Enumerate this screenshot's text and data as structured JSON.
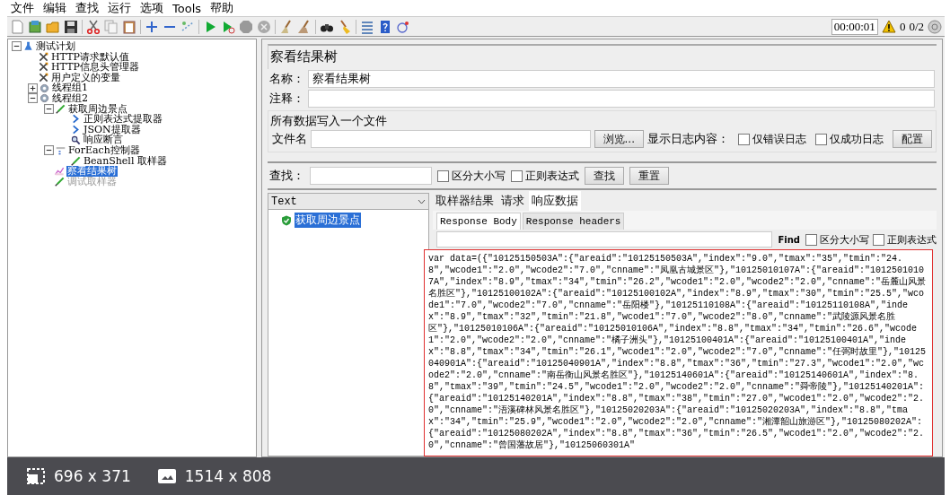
{
  "menu": [
    "文件",
    "编辑",
    "查找",
    "运行",
    "选项",
    "Tools",
    "帮助"
  ],
  "toolbar": {
    "timer": "00:00:01",
    "error_count": "0",
    "threads": "0/2"
  },
  "tree": [
    {
      "label": "测试计划",
      "kind": "plan",
      "expanded": true,
      "selected": false,
      "disabled": false,
      "children": [
        {
          "label": "HTTP请求默认值",
          "kind": "config",
          "selected": false,
          "disabled": false
        },
        {
          "label": "HTTP信息头管理器",
          "kind": "config",
          "selected": false,
          "disabled": false
        },
        {
          "label": "用户定义的变量",
          "kind": "config",
          "selected": false,
          "disabled": false
        },
        {
          "label": "线程组1",
          "kind": "threadgroup",
          "expanded": false,
          "selected": false,
          "disabled": false
        },
        {
          "label": "线程组2",
          "kind": "threadgroup",
          "expanded": true,
          "selected": false,
          "disabled": false,
          "children": [
            {
              "label": "获取周边景点",
              "kind": "sampler",
              "expanded": true,
              "selected": false,
              "disabled": false,
              "children": [
                {
                  "label": "正则表达式提取器",
                  "kind": "postprocessor",
                  "selected": false,
                  "disabled": false
                },
                {
                  "label": "JSON提取器",
                  "kind": "postprocessor",
                  "selected": false,
                  "disabled": false
                },
                {
                  "label": "响应断言",
                  "kind": "assertion",
                  "selected": false,
                  "disabled": false
                }
              ]
            },
            {
              "label": "ForEach控制器",
              "kind": "controller",
              "expanded": true,
              "selected": false,
              "disabled": false,
              "children": [
                {
                  "label": "BeanShell 取样器",
                  "kind": "sampler",
                  "selected": false,
                  "disabled": false
                }
              ]
            },
            {
              "label": "察看结果树",
              "kind": "listener",
              "selected": true,
              "disabled": false
            },
            {
              "label": "调试取样器",
              "kind": "sampler",
              "selected": false,
              "disabled": true
            }
          ]
        }
      ]
    }
  ],
  "editor": {
    "title": "察看结果树",
    "name_label": "名称：",
    "name_value": "察看结果树",
    "comment_label": "注释：",
    "file_group": {
      "legend": "所有数据写入一个文件",
      "filename_label": "文件名",
      "browse": "浏览...",
      "log_label": "显示日志内容：",
      "checks": [
        {
          "label": "仅错误日志",
          "checked": false
        },
        {
          "label": "仅成功日志",
          "checked": false
        }
      ],
      "config": "配置"
    },
    "search": {
      "label": "查找：",
      "checks": [
        {
          "label": "区分大小写",
          "checked": false
        },
        {
          "label": "正则表达式",
          "checked": false
        }
      ],
      "buttons": [
        "查找",
        "重置"
      ]
    },
    "results": {
      "renderer": "Text",
      "items": [
        {
          "label": "获取周边景点",
          "success": true,
          "selected": true
        }
      ],
      "tabs": [
        {
          "label": "取样器结果",
          "selected": false
        },
        {
          "label": "请求",
          "selected": false
        },
        {
          "label": "响应数据",
          "selected": true
        }
      ],
      "subtabs": [
        {
          "label": "Response Body",
          "selected": true
        },
        {
          "label": "Response headers",
          "selected": false
        }
      ],
      "find": {
        "button": "Find",
        "checks": [
          {
            "label": "区分大小写",
            "checked": false
          },
          {
            "label": "正则表达式",
            "checked": false
          }
        ]
      },
      "response": "var data=({\"10125150503A\":{\"areaid\":\"10125150503A\",\"index\":\"9.0\",\"tmax\":\"35\",\"tmin\":\"24.8\",\"wcode1\":\"2.0\",\"wcode2\":\"7.0\",\"cnname\":\"凤凰古城景区\"},\"10125010107A\":{\"areaid\":\"10125010107A\",\"index\":\"8.9\",\"tmax\":\"34\",\"tmin\":\"26.2\",\"wcode1\":\"2.0\",\"wcode2\":\"2.0\",\"cnname\":\"岳麓山风景名胜区\"},\"10125100102A\":{\"areaid\":\"10125100102A\",\"index\":\"8.9\",\"tmax\":\"30\",\"tmin\":\"25.5\",\"wcode1\":\"7.0\",\"wcode2\":\"7.0\",\"cnname\":\"岳阳楼\"},\"10125110108A\":{\"areaid\":\"10125110108A\",\"index\":\"8.9\",\"tmax\":\"32\",\"tmin\":\"21.8\",\"wcode1\":\"7.0\",\"wcode2\":\"8.0\",\"cnname\":\"武陵源风景名胜区\"},\"10125010106A\":{\"areaid\":\"10125010106A\",\"index\":\"8.8\",\"tmax\":\"34\",\"tmin\":\"26.6\",\"wcode1\":\"2.0\",\"wcode2\":\"2.0\",\"cnname\":\"橘子洲头\"},\"10125100401A\":{\"areaid\":\"10125100401A\",\"index\":\"8.8\",\"tmax\":\"34\",\"tmin\":\"26.1\",\"wcode1\":\"2.0\",\"wcode2\":\"7.0\",\"cnname\":\"任弼时故里\"},\"10125040901A\":{\"areaid\":\"10125040901A\",\"index\":\"8.8\",\"tmax\":\"36\",\"tmin\":\"27.3\",\"wcode1\":\"2.0\",\"wcode2\":\"2.0\",\"cnname\":\"南岳衡山风景名胜区\"},\"10125140601A\":{\"areaid\":\"10125140601A\",\"index\":\"8.8\",\"tmax\":\"39\",\"tmin\":\"24.5\",\"wcode1\":\"2.0\",\"wcode2\":\"2.0\",\"cnname\":\"舜帝陵\"},\"10125140201A\":{\"areaid\":\"10125140201A\",\"index\":\"8.8\",\"tmax\":\"38\",\"tmin\":\"27.0\",\"wcode1\":\"2.0\",\"wcode2\":\"2.0\",\"cnname\":\"浯溪碑林风景名胜区\"},\"10125020203A\":{\"areaid\":\"10125020203A\",\"index\":\"8.8\",\"tmax\":\"34\",\"tmin\":\"25.9\",\"wcode1\":\"2.0\",\"wcode2\":\"2.0\",\"cnname\":\"湘潭韶山旅游区\"},\"10125080202A\":{\"areaid\":\"10125080202A\",\"index\":\"8.8\",\"tmax\":\"36\",\"tmin\":\"26.5\",\"wcode1\":\"2.0\",\"wcode2\":\"2.0\",\"cnname\":\"曾国藩故居\"},\"10125060301A\""
    }
  },
  "size_bar": {
    "display_size": "696 x 371",
    "original_size": "1514 x 808"
  }
}
